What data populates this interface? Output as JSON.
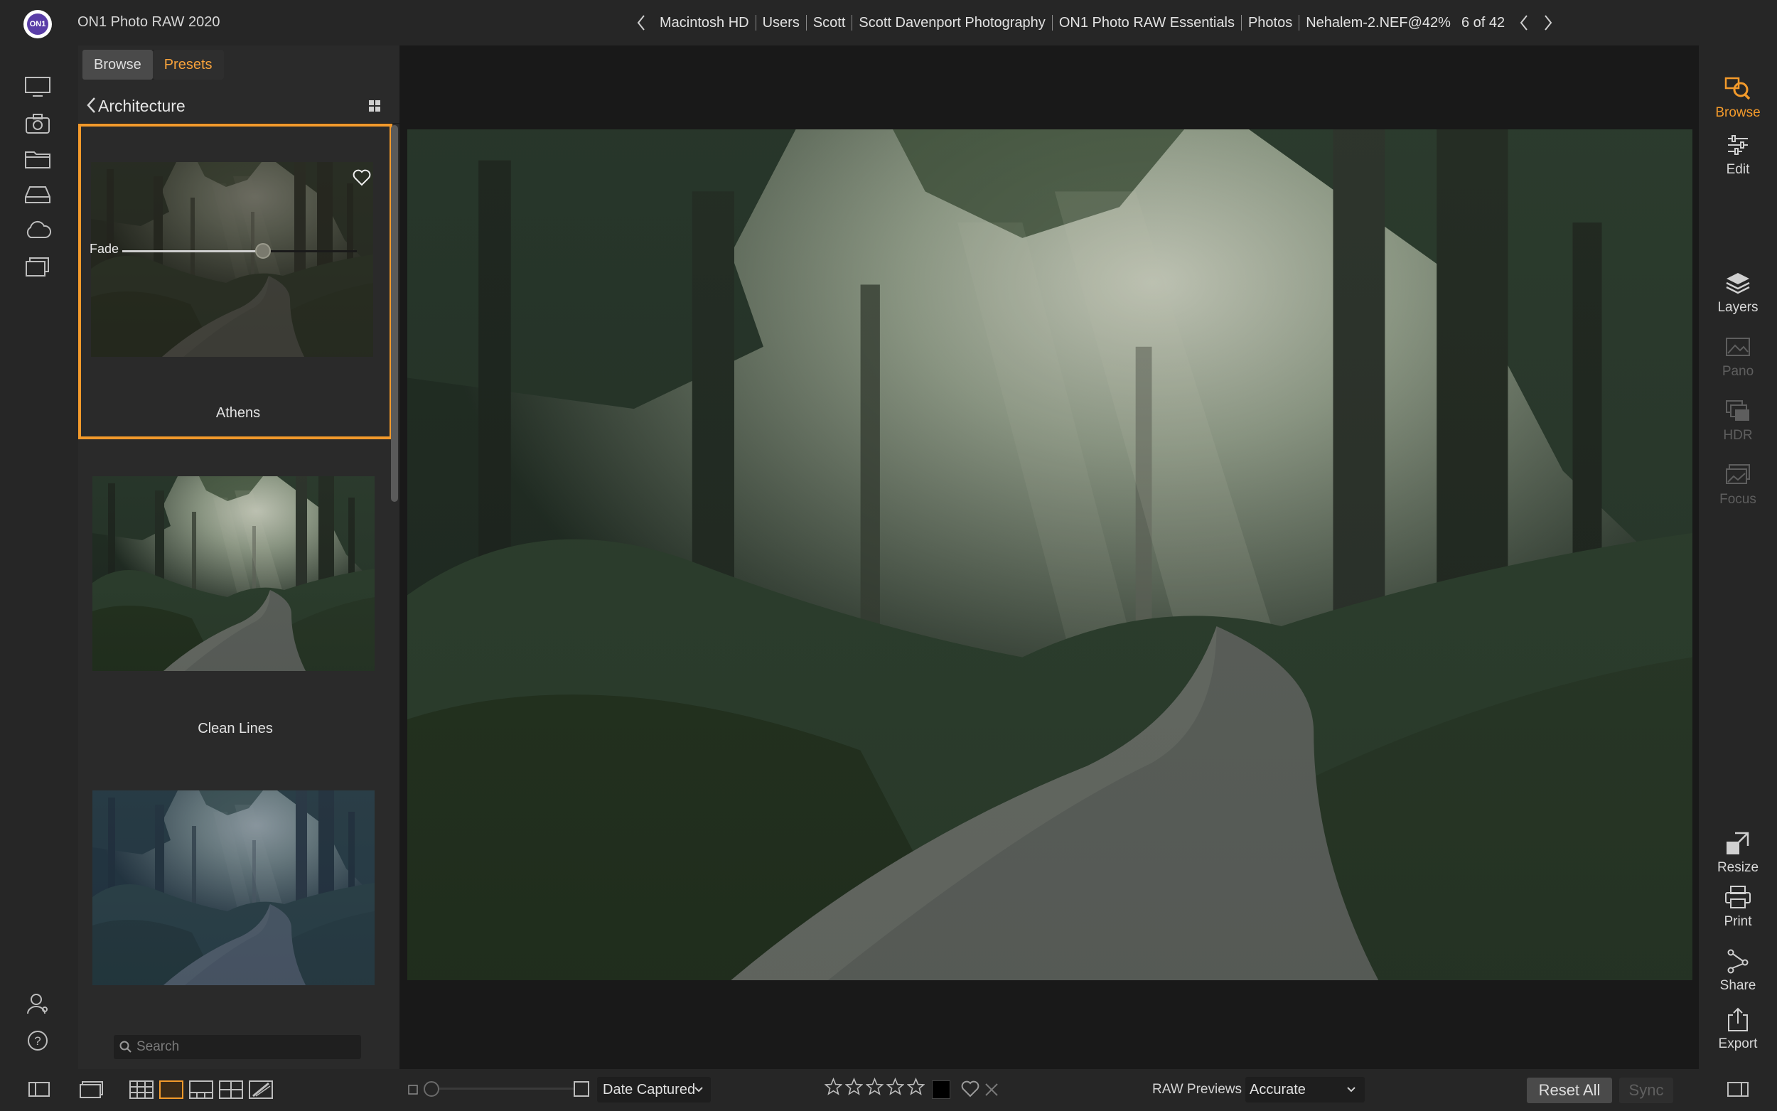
{
  "app": {
    "title": "ON1 Photo RAW 2020"
  },
  "breadcrumb": [
    "Macintosh HD",
    "Users",
    "Scott",
    "Scott Davenport Photography",
    "ON1 Photo RAW Essentials",
    "Photos",
    "Nehalem-2.NEF@42%"
  ],
  "navigation": {
    "count": "6 of 42"
  },
  "left_rail": {
    "icons": [
      "local-drives-icon",
      "camera-import-icon",
      "folder-icon",
      "drive-icon",
      "cloud-icon",
      "albums-icon",
      "account-icon",
      "help-icon"
    ]
  },
  "panel": {
    "tabs": [
      {
        "label": "Browse"
      },
      {
        "label": "Presets"
      }
    ],
    "category": "Architecture",
    "presets": [
      {
        "name": "Athens",
        "selected": true,
        "fade_label": "Fade",
        "fade_value_fraction": 0.6
      },
      {
        "name": "Clean Lines",
        "selected": false
      },
      {
        "name": "",
        "selected": false
      }
    ],
    "search_placeholder": "Search"
  },
  "modules": [
    {
      "label": "Browse",
      "state": "active"
    },
    {
      "label": "Edit",
      "state": "normal"
    },
    {
      "label": "Layers",
      "state": "normal"
    },
    {
      "label": "Pano",
      "state": "disabled"
    },
    {
      "label": "HDR",
      "state": "disabled"
    },
    {
      "label": "Focus",
      "state": "disabled"
    },
    {
      "label": "Resize",
      "state": "normal"
    },
    {
      "label": "Print",
      "state": "normal"
    },
    {
      "label": "Share",
      "state": "normal"
    },
    {
      "label": "Export",
      "state": "normal"
    }
  ],
  "bottom": {
    "sort_by": "Date Captured",
    "rating_stars": 5,
    "rating_value": 0,
    "raw_previews_label": "RAW Previews",
    "raw_previews_value": "Accurate",
    "reset_all": "Reset All",
    "sync": "Sync"
  },
  "colors": {
    "accent": "#f39a2b",
    "panel_bg": "#2a2a2a",
    "viewer_bg": "#191919"
  }
}
